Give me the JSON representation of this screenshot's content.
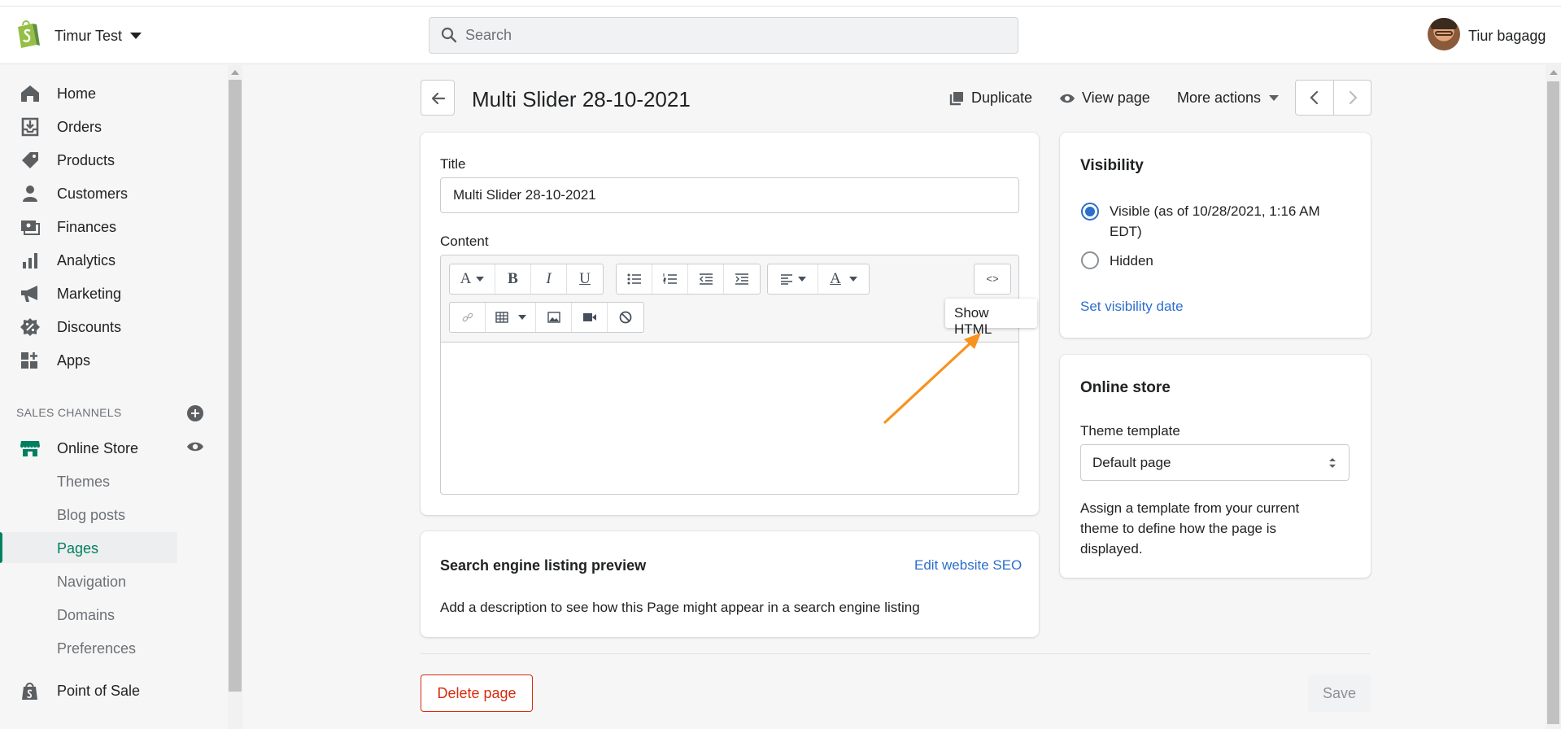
{
  "topbar": {
    "store_name": "Timur Test",
    "search_placeholder": "Search",
    "user_name": "Tiur bagagg"
  },
  "sidebar": {
    "items": [
      {
        "label": "Home",
        "icon": "home-icon"
      },
      {
        "label": "Orders",
        "icon": "orders-icon"
      },
      {
        "label": "Products",
        "icon": "tag-icon"
      },
      {
        "label": "Customers",
        "icon": "person-icon"
      },
      {
        "label": "Finances",
        "icon": "finances-icon"
      },
      {
        "label": "Analytics",
        "icon": "bar-chart-icon"
      },
      {
        "label": "Marketing",
        "icon": "megaphone-icon"
      },
      {
        "label": "Discounts",
        "icon": "discount-icon"
      },
      {
        "label": "Apps",
        "icon": "apps-icon"
      }
    ],
    "sales_channels_label": "SALES CHANNELS",
    "online_store": "Online Store",
    "sub_items": [
      "Themes",
      "Blog posts",
      "Pages",
      "Navigation",
      "Domains",
      "Preferences"
    ],
    "active_sub_item": "Pages",
    "point_of_sale": "Point of Sale"
  },
  "header": {
    "title": "Multi Slider 28-10-2021",
    "duplicate": "Duplicate",
    "view_page": "View page",
    "more_actions": "More actions"
  },
  "main_card": {
    "title_label": "Title",
    "title_value": "Multi Slider 28-10-2021",
    "content_label": "Content",
    "toolbar_row1": [
      "A",
      "B",
      "I",
      "U"
    ],
    "html_button": "<>",
    "tooltip": "Show HTML",
    "annotation_arrow_color": "#f7931e"
  },
  "seo_card": {
    "title": "Search engine listing preview",
    "edit_link": "Edit website SEO",
    "description": "Add a description to see how this Page might appear in a search engine listing"
  },
  "visibility_card": {
    "title": "Visibility",
    "visible_label": "Visible (as of 10/28/2021, 1:16 AM EDT)",
    "visible_line1": "Visible (as of 10/28/2021, 1:16 AM",
    "visible_line2": "EDT)",
    "hidden_label": "Hidden",
    "selected": "visible",
    "set_date_link": "Set visibility date"
  },
  "online_store_card": {
    "title": "Online store",
    "template_label": "Theme template",
    "template_value": "Default page",
    "help_text_line1": "Assign a template from your current",
    "help_text_line2": "theme to define how the page is",
    "help_text_line3": "displayed."
  },
  "footer": {
    "delete_button": "Delete page",
    "save_button": "Save"
  },
  "colors": {
    "brand_green": "#008060",
    "link_blue": "#2c6ecb",
    "critical_red": "#d72c0d"
  }
}
